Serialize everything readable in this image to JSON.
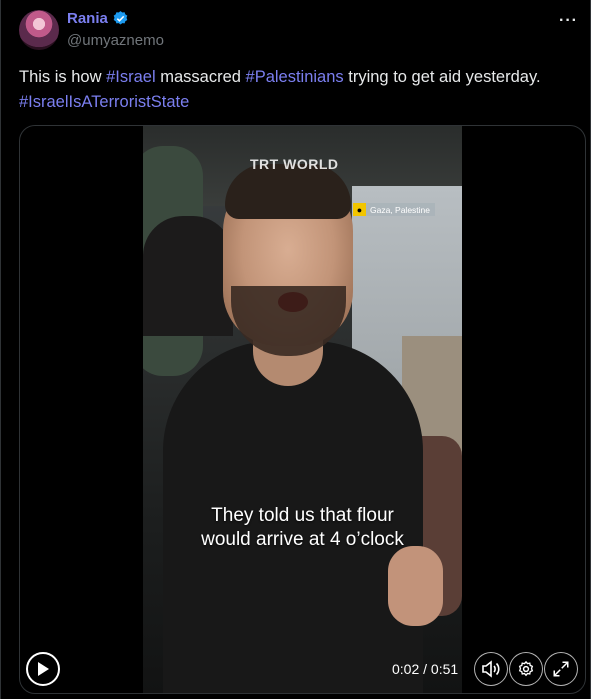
{
  "author": {
    "name": "Rania",
    "handle": "@umyaznemo",
    "verified_icon": "verified-badge-icon",
    "accent": "#7b7ff0"
  },
  "more_label": "···",
  "tweet": {
    "part1": "This is how ",
    "tag1": "#Israel",
    "part2": " massacred ",
    "tag2": "#Palestinians",
    "part3": " trying to get aid yesterday.",
    "tag3": "#IsraelIsATerroristState"
  },
  "video": {
    "watermark": "TRT WORLD",
    "location": "Gaza, Palestine",
    "caption_line1": "They told us that flour",
    "caption_line2": "would arrive at 4 o’clock",
    "time": "0:02 / 0:51",
    "controls": [
      "play-icon",
      "volume-icon",
      "settings-icon",
      "fullscreen-icon"
    ]
  }
}
